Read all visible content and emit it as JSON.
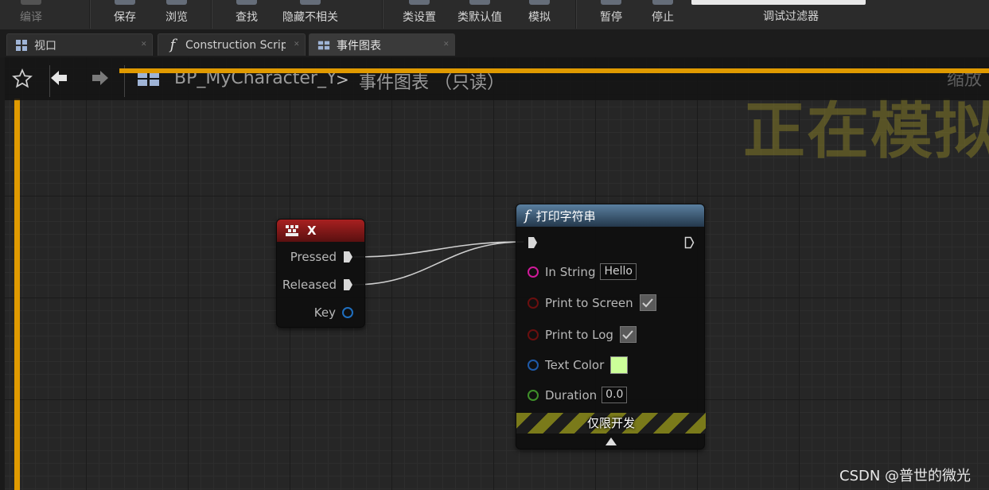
{
  "toolbar": {
    "compile": "编译",
    "save": "保存",
    "browse": "浏览",
    "find": "查找",
    "hide_unrelated": "隐藏不相关",
    "class_settings": "类设置",
    "class_defaults": "类默认值",
    "simulate": "模拟",
    "pause": "暂停",
    "stop": "停止",
    "debug_filter": "调试过滤器"
  },
  "tabs": [
    {
      "label": "视口",
      "icon": "viewport-icon"
    },
    {
      "label": "Construction Scrip",
      "icon": "function-icon"
    },
    {
      "label": "事件图表",
      "icon": "event-graph-icon"
    }
  ],
  "breadcrumb": {
    "blueprint": "BP_MyCharacter_Y",
    "separator": ">",
    "graph": "事件图表 （只读）",
    "zoom": "缩放"
  },
  "watermark": "正在模拟",
  "node_x": {
    "title": "X",
    "pins": {
      "pressed": "Pressed",
      "released": "Released",
      "key": "Key"
    }
  },
  "node_print": {
    "title": "打印字符串",
    "in_string": {
      "label": "In String",
      "value": "Hello"
    },
    "print_to_screen": {
      "label": "Print to Screen",
      "checked": true
    },
    "print_to_log": {
      "label": "Print to Log",
      "checked": true
    },
    "text_color": {
      "label": "Text Color",
      "color": "#ccff99"
    },
    "duration": {
      "label": "Duration",
      "value": "0.0"
    },
    "dev_only": "仅限开发"
  },
  "colors": {
    "simulation_border": "#e09a00",
    "input_node_header": "#8b1a1a",
    "function_node_header": "#3b5a78"
  },
  "credit": "CSDN @普世的微光"
}
